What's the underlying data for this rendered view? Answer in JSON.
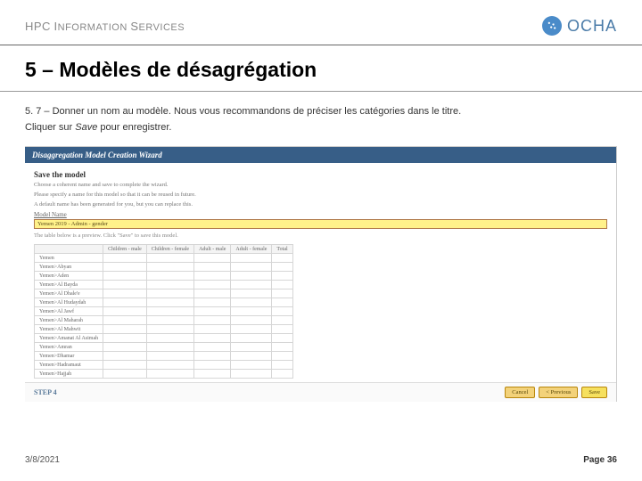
{
  "header": {
    "left_brand_html": "HPC INFORMATION SERVICES",
    "left_brand": {
      "hpc": "HPC",
      "info": "I",
      "nformation": "NFORMATION",
      "s": "S",
      "ervices": "ERVICES"
    },
    "ocha": "OCHA"
  },
  "title": "5 – Modèles de désagrégation",
  "body": {
    "line1_prefix": "5. 7 – Donner un nom au modèle. Nous vous recommandons de préciser les catégories dans le titre.",
    "line2_prefix": "Cliquer sur ",
    "line2_italic": "Save ",
    "line2_suffix": "pour enregistrer."
  },
  "wizard": {
    "header": "Disaggregation Model Creation Wizard",
    "save_heading": "Save the model",
    "save_sub": "Choose a coherent name and save to complete the wizard.",
    "specify": "Please specify a name for this model so that it can be reused in future.",
    "default_note": "A default name has been generated for you, but you can replace this.",
    "label_model_name": "Model Name",
    "input_value": "Yemen 2019 - Admin - gender",
    "preview_note": "The table below is a preview. Click \"Save\" to save this model.",
    "table": {
      "corner": "",
      "columns": [
        "Children - male",
        "Children - female",
        "Adult - male",
        "Adult - female",
        "Total"
      ],
      "rows": [
        "Yemen",
        "Yemen>Abyan",
        "Yemen>Aden",
        "Yemen>Al Bayda",
        "Yemen>Al Dhale'e",
        "Yemen>Al Hudaydah",
        "Yemen>Al Jawf",
        "Yemen>Al Maharah",
        "Yemen>Al Mahwit",
        "Yemen>Amanat Al Asimah",
        "Yemen>Amran",
        "Yemen>Dhamar",
        "Yemen>Hadramaut",
        "Yemen>Hajjah"
      ]
    },
    "step_label": "STEP 4",
    "buttons": {
      "cancel": "Cancel",
      "prev": "< Previous",
      "save": "Save"
    }
  },
  "footer": {
    "date": "3/8/2021",
    "page_word": "Page ",
    "page_num": "36"
  }
}
